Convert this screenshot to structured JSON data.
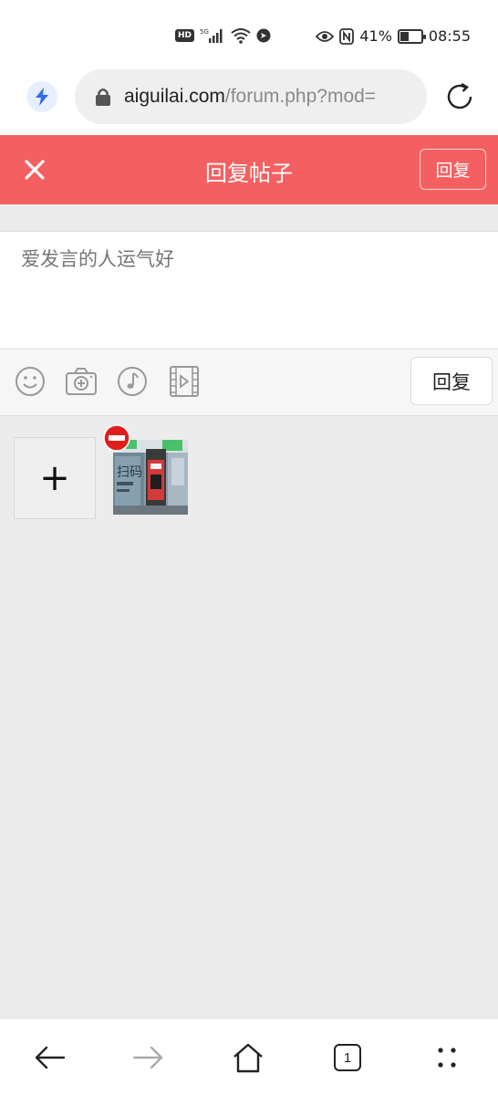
{
  "status_bar": {
    "signal_label": "5G",
    "hd_label": "HD",
    "battery_percent": "41%",
    "battery_level": 0.41,
    "time": "08:55"
  },
  "browser": {
    "url_domain": "aiguilai.com",
    "url_path": "/forum.php?mod=",
    "icons": [
      "speed-icon",
      "lock-icon",
      "reload-icon"
    ]
  },
  "header": {
    "title": "回复帖子",
    "reply_label": "回复",
    "background_color": "#f46061"
  },
  "compose": {
    "placeholder": "爱发言的人运气好",
    "value": ""
  },
  "toolbar": {
    "icons": [
      "emoji-icon",
      "camera-icon",
      "music-icon",
      "video-icon"
    ],
    "reply_label": "回复"
  },
  "attachments": {
    "add_symbol": "+",
    "thumb_text": "扫码"
  },
  "bottom_nav": {
    "tab_count": "1",
    "icons": [
      "back-icon",
      "forward-icon",
      "home-icon",
      "tabs-icon",
      "menu-icon"
    ]
  }
}
